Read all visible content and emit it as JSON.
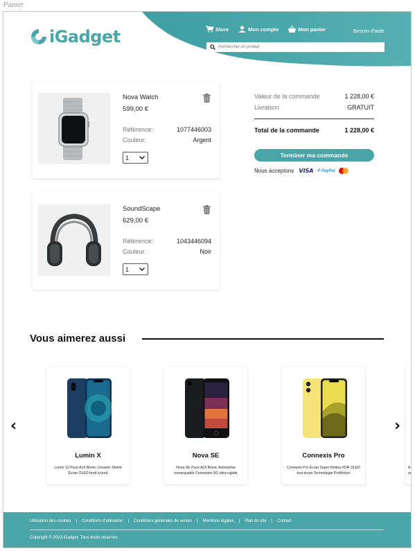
{
  "window": {
    "frame_label": "Panier"
  },
  "brand": {
    "name": "iGadget",
    "primary_color": "#4aa5a8"
  },
  "header": {
    "nav": [
      {
        "label": "Store",
        "icon": "cart-icon"
      },
      {
        "label": "Mon compte",
        "icon": "user-icon"
      },
      {
        "label": "Mon panier",
        "icon": "basket-icon"
      }
    ],
    "help_label": "Besoin d'aide",
    "search": {
      "placeholder": "Rechercher un produit",
      "value": ""
    }
  },
  "cart": {
    "items": [
      {
        "name": "Nova Watch",
        "price": "599,00 €",
        "ref_label": "Référence:",
        "ref_value": "1077446003",
        "color_label": "Couleur:",
        "color_value": "Argent",
        "qty": "1",
        "image": "watch-image"
      },
      {
        "name": "SoundScape",
        "price": "629,00 €",
        "ref_label": "Référence:",
        "ref_value": "1043446094",
        "color_label": "Couleur:",
        "color_value": "Noir",
        "qty": "1",
        "image": "headphones-image"
      }
    ]
  },
  "summary": {
    "order_value_label": "Valeur de la commande",
    "order_value": "1 228,00 €",
    "delivery_label": "Livraison",
    "delivery_value": "GRATUIT",
    "total_label": "Total de la commande",
    "total_value": "1 228,00 €",
    "checkout_label": "Terminer ma commande",
    "accept_label": "Nous acceptons",
    "payment_visa": "VISA",
    "payment_paypal_1": "P PayPal",
    "payment_paypal_2": ""
  },
  "recommendations": {
    "title": "Vous aimerez aussi",
    "products": [
      {
        "name": "Lumin X",
        "desc": "Lumin 12 Puce A14 Bionic Ceramic Shield Écran OLED bord à bord",
        "color": "blue"
      },
      {
        "name": "Nova SE",
        "desc": "Nova SE Puce A15 Bionic Autonomie remarquable Connexion 5G ultra-rapide",
        "color": "black"
      },
      {
        "name": "Connexis Pro",
        "desc": "Connexis Pro Écran Super Retina XDR OLED tout écran Technologie ProMotion",
        "color": "yellow"
      }
    ],
    "peek_text_1": "A",
    "peek_text_2": "re",
    "prev_label": "‹",
    "next_label": "›"
  },
  "footer": {
    "links": [
      "Utilisation des cookies",
      "Conditions d'utilisation",
      "Conditions générales de ventes",
      "Mentions légales",
      "Plan du site",
      "Contact"
    ],
    "separator": "|",
    "copyright": "Copyright © 2023 iGadget. Tous droits réservés."
  }
}
